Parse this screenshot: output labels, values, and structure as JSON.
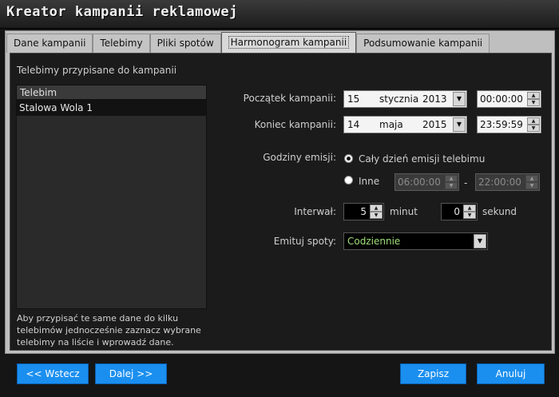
{
  "window": {
    "title": "Kreator kampanii reklamowej"
  },
  "tabs": [
    {
      "label": "Dane kampanii"
    },
    {
      "label": "Telebimy"
    },
    {
      "label": "Pliki spotów"
    },
    {
      "label": "Harmonogram kampanii",
      "active": true
    },
    {
      "label": "Podsumowanie kampanii"
    }
  ],
  "telebimy": {
    "heading": "Telebimy przypisane do kampanii",
    "column": "Telebim",
    "rows": [
      "Stalowa Wola 1"
    ],
    "hint": "Aby przypisać te same dane do kilku telebimów jednocześnie zaznacz wybrane telebimy na liście i wprowadź dane."
  },
  "schedule": {
    "start_label": "Początek kampanii:",
    "start_day": "15",
    "start_month": "stycznia",
    "start_year": "2013",
    "start_time": "00:00:00",
    "end_label": "Koniec kampanii:",
    "end_day": "14",
    "end_month": "maja",
    "end_year": "2015",
    "end_time": "23:59:59",
    "hours_label": "Godziny emisji:",
    "option_all_day": "Cały dzień emisji telebimu",
    "option_other": "Inne",
    "other_from": "06:00:00",
    "other_dash": "-",
    "other_to": "22:00:00",
    "interval_label": "Interwał:",
    "interval_minutes": "5",
    "minutes_unit": "minut",
    "interval_seconds": "0",
    "seconds_unit": "sekund",
    "emit_label": "Emituj spoty:",
    "emit_value": "Codziennie"
  },
  "buttons": {
    "back": "<< Wstecz",
    "next": "Dalej >>",
    "save": "Zapisz",
    "cancel": "Anuluj"
  },
  "colors": {
    "accent": "#1a8ff0",
    "background": "#151515",
    "tab_bar": "#bfbfbf"
  }
}
